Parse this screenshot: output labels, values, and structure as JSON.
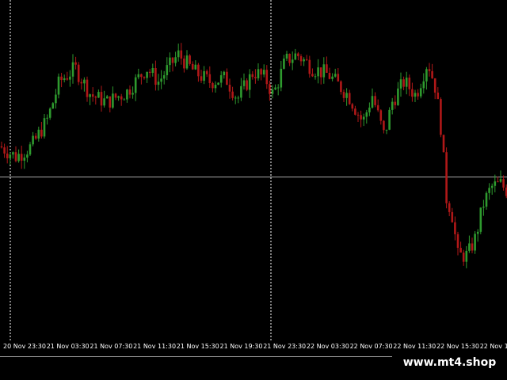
{
  "colors": {
    "background": "#000000",
    "bull_candle": "#2e9a2e",
    "bear_candle": "#b01818",
    "crosshair": "#a8a8a8",
    "separator": "#ffffff",
    "axis_text": "#ffffff",
    "border": "#9a9a9a"
  },
  "watermark": {
    "text": "www.mt4.shop"
  },
  "chart_data": {
    "type": "candlestick",
    "title": "",
    "xlabel": "",
    "ylabel": "",
    "grid": false,
    "legend": "none",
    "ylim": [
      0,
      100
    ],
    "x_tick_labels": [
      "20 Nov 23:30",
      "21 Nov 03:30",
      "21 Nov 07:30",
      "21 Nov 11:30",
      "21 Nov 15:30",
      "21 Nov 19:30",
      "21 Nov 23:30",
      "22 Nov 03:30",
      "22 Nov 07:30",
      "22 Nov 11:30",
      "22 Nov 15:30",
      "22 Nov 1"
    ],
    "day_separators_at_tick": [
      0,
      6
    ],
    "crosshair_value": 48,
    "candles": []
  }
}
